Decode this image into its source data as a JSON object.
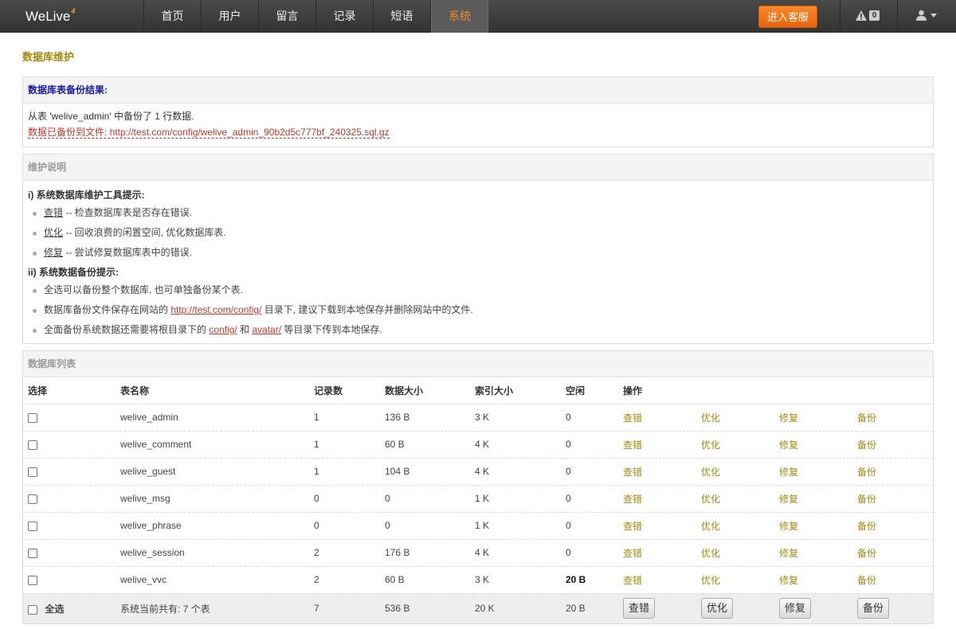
{
  "header": {
    "logo": "WeLive",
    "logo_sup": "4",
    "nav": [
      "首页",
      "用户",
      "留言",
      "记录",
      "短语",
      "系统"
    ],
    "active_nav": "系统",
    "support_button": "进入客服",
    "alert_count": "0",
    "accent_color": "#f08a24"
  },
  "page": {
    "title": "数据库维护"
  },
  "backup_result": {
    "heading": "数据库表备份结果:",
    "line1": "从表 'welive_admin' 中备份了 1 行数据.",
    "line2": "数据已备份到文件: http://test.com/config/welive_admin_90b2d5c777bf_240325.sql.gz"
  },
  "maintenance": {
    "heading": "维护说明",
    "section1_title": "i) 系统数据库维护工具提示:",
    "tips1": [
      {
        "key": "查错",
        "text": " -- 检查数据库表是否存在错误."
      },
      {
        "key": "优化",
        "text": " -- 回收浪费的闲置空间, 优化数据库表."
      },
      {
        "key": "修复",
        "text": " -- 尝试修复数据库表中的错误."
      }
    ],
    "section2_title": "ii) 系统数据备份提示:",
    "tip2_1": "全选可以备份整个数据库, 也可单独备份某个表.",
    "tip2_2_pre": "数据库备份文件保存在网站的 ",
    "tip2_2_link": "http://test.com/config/",
    "tip2_2_post": " 目录下, 建议下载到本地保存并删除网站中的文件.",
    "tip2_3_pre": "全面备份系统数据还需要将根目录下的 ",
    "tip2_3_link1": "config/",
    "tip2_3_mid": " 和 ",
    "tip2_3_link2": "avatar/",
    "tip2_3_post": " 等目录下传到本地保存."
  },
  "db_list": {
    "heading": "数据库列表",
    "columns": [
      "选择",
      "表名称",
      "记录数",
      "数据大小",
      "索引大小",
      "空闲",
      "操作"
    ],
    "actions": [
      "查错",
      "优化",
      "修复",
      "备份"
    ],
    "rows": [
      {
        "name": "welive_admin",
        "records": "1",
        "data_size": "136 B",
        "index_size": "3 K",
        "free": "0"
      },
      {
        "name": "welive_comment",
        "records": "1",
        "data_size": "60 B",
        "index_size": "4 K",
        "free": "0"
      },
      {
        "name": "welive_guest",
        "records": "1",
        "data_size": "104 B",
        "index_size": "4 K",
        "free": "0"
      },
      {
        "name": "welive_msg",
        "records": "0",
        "data_size": "0",
        "index_size": "1 K",
        "free": "0"
      },
      {
        "name": "welive_phrase",
        "records": "0",
        "data_size": "0",
        "index_size": "1 K",
        "free": "0"
      },
      {
        "name": "welive_session",
        "records": "2",
        "data_size": "176 B",
        "index_size": "4 K",
        "free": "0"
      },
      {
        "name": "welive_vvc",
        "records": "2",
        "data_size": "60 B",
        "index_size": "3 K",
        "free": "20 B"
      }
    ],
    "footer": {
      "select_all": "全选",
      "summary": "系统当前共有: 7 个表",
      "records": "7",
      "data_size": "536 B",
      "index_size": "20 K",
      "free": "20 B",
      "buttons": [
        "查错",
        "优化",
        "修复",
        "备份"
      ]
    }
  }
}
